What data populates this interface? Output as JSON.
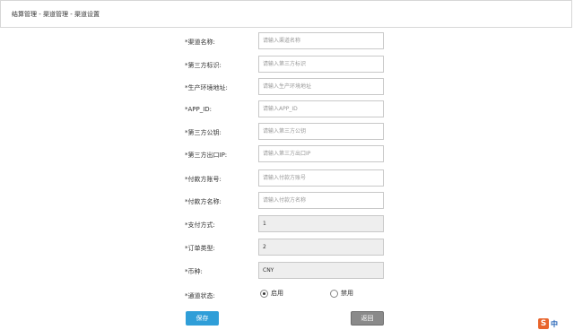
{
  "breadcrumb": "结算管理 - 渠道管理 - 渠道设置",
  "form": {
    "fields": [
      {
        "label": "*渠道名称:",
        "placeholder": "请输入渠道名称",
        "value": ""
      },
      {
        "label": "*第三方标识:",
        "placeholder": "请输入第三方标识",
        "value": ""
      },
      {
        "label": "*生产环境地址:",
        "placeholder": "请输入生产环境地址",
        "value": ""
      },
      {
        "label": "*APP_ID:",
        "placeholder": "请输入APP_ID",
        "value": ""
      },
      {
        "label": "*第三方公钥:",
        "placeholder": "请输入第三方公钥",
        "value": ""
      },
      {
        "label": "*第三方出口IP:",
        "placeholder": "请输入第三方出口IP",
        "value": ""
      },
      {
        "label": "*付款方账号:",
        "placeholder": "请输入付款方账号",
        "value": ""
      },
      {
        "label": "*付款方名称:",
        "placeholder": "请输入付款方名称",
        "value": ""
      },
      {
        "label": "*支付方式:",
        "placeholder": "",
        "value": "1"
      },
      {
        "label": "*订单类型:",
        "placeholder": "",
        "value": "2"
      },
      {
        "label": "*币种:",
        "placeholder": "",
        "value": "CNY"
      }
    ],
    "status": {
      "label": "*通道状态:",
      "options": [
        {
          "label": "启用",
          "checked": true
        },
        {
          "label": "禁用",
          "checked": false
        }
      ]
    }
  },
  "buttons": {
    "save": "保存",
    "back": "返回"
  },
  "corner_badge": {
    "icon": "s-logo-icon",
    "text": "中"
  }
}
